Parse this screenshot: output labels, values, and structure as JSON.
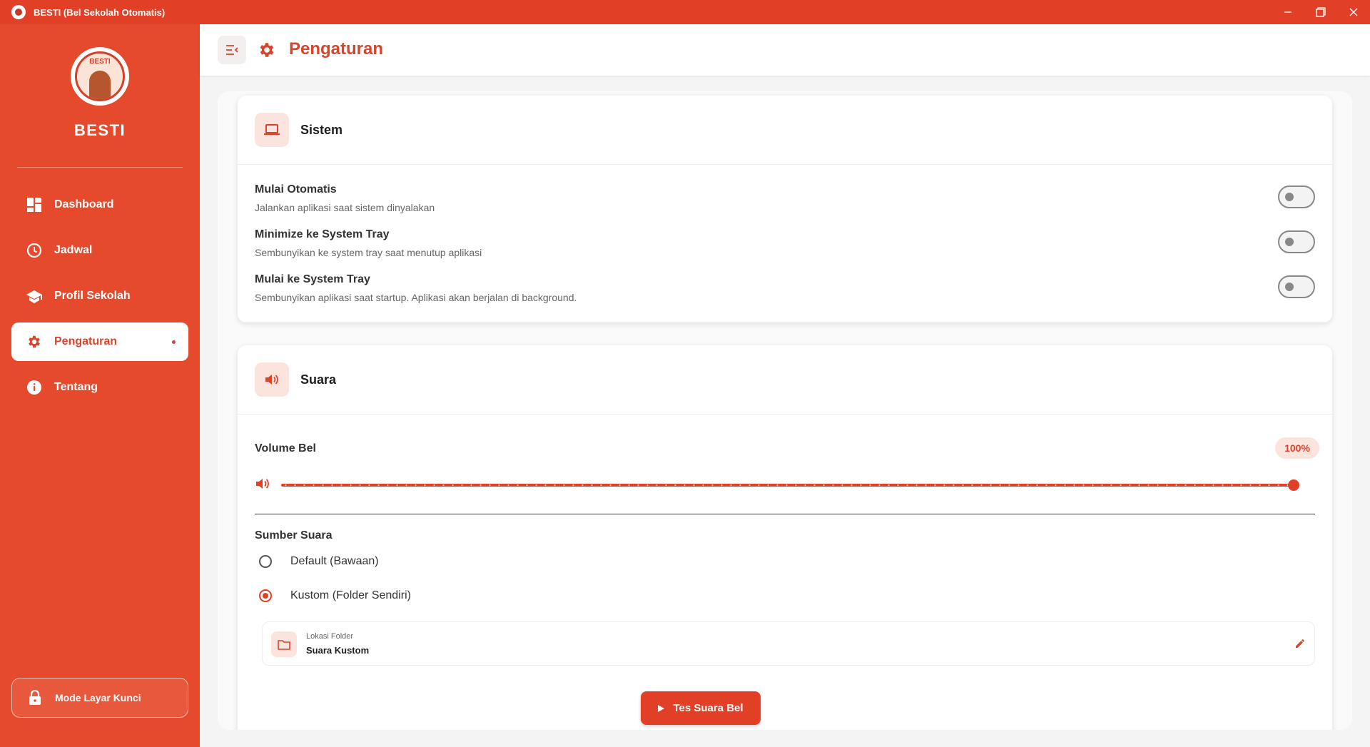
{
  "window": {
    "title": "BESTI (Bel Sekolah Otomatis)"
  },
  "sidebar": {
    "brand": "BESTI",
    "logo_text": "BESTI",
    "items": [
      {
        "label": "Dashboard",
        "icon": "dashboard-icon"
      },
      {
        "label": "Jadwal",
        "icon": "clock-icon"
      },
      {
        "label": "Profil Sekolah",
        "icon": "school-icon"
      },
      {
        "label": "Pengaturan",
        "icon": "gear-icon",
        "active": true
      },
      {
        "label": "Tentang",
        "icon": "info-icon"
      }
    ],
    "lock_label": "Mode Layar Kunci"
  },
  "header": {
    "title": "Pengaturan"
  },
  "sistem": {
    "title": "Sistem",
    "settings": [
      {
        "title": "Mulai Otomatis",
        "desc": "Jalankan aplikasi saat sistem dinyalakan",
        "enabled": false
      },
      {
        "title": "Minimize ke System Tray",
        "desc": "Sembunyikan ke system tray saat menutup aplikasi",
        "enabled": false
      },
      {
        "title": "Mulai ke System Tray",
        "desc": "Sembunyikan aplikasi saat startup. Aplikasi akan berjalan di background.",
        "enabled": false
      }
    ]
  },
  "suara": {
    "title": "Suara",
    "volume_label": "Volume Bel",
    "volume_text": "100%",
    "volume_value": 1.0,
    "source_label": "Sumber Suara",
    "options": [
      {
        "label": "Default (Bawaan)",
        "selected": false
      },
      {
        "label": "Kustom (Folder Sendiri)",
        "selected": true
      }
    ],
    "folder_caption": "Lokasi Folder",
    "folder_name": "Suara Kustom",
    "test_button": "Tes Suara Bel"
  },
  "colors": {
    "accent": "#e23f27",
    "sidebar": "#e54a2c",
    "accent_light": "#fbe4de"
  }
}
